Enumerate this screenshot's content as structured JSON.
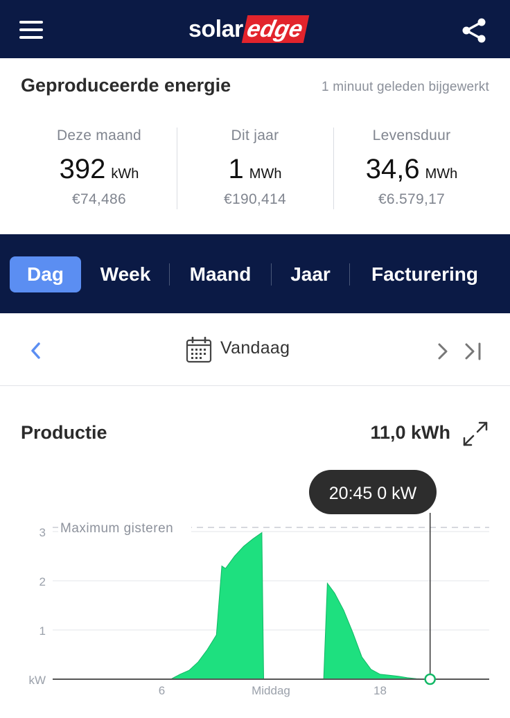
{
  "header": {
    "logo_text_1": "solar",
    "logo_text_2": "edge",
    "menu_icon": "hamburger-menu-icon",
    "share_icon": "share-icon"
  },
  "energy": {
    "title": "Geproduceerde energie",
    "updated": "1 minuut geleden bijgewerkt",
    "stats": [
      {
        "label": "Deze maand",
        "value": "392",
        "unit": "kWh",
        "money": "€74,486"
      },
      {
        "label": "Dit jaar",
        "value": "1",
        "unit": "MWh",
        "money": "€190,414"
      },
      {
        "label": "Levensduur",
        "value": "34,6",
        "unit": "MWh",
        "money": "€6.579,17"
      }
    ]
  },
  "tabs": [
    {
      "label": "Dag",
      "active": true
    },
    {
      "label": "Week",
      "active": false
    },
    {
      "label": "Maand",
      "active": false
    },
    {
      "label": "Jaar",
      "active": false
    },
    {
      "label": "Facturering",
      "active": false
    }
  ],
  "datebar": {
    "label": "Vandaag",
    "calendar_icon": "calendar-icon",
    "prev_icon": "chevron-left-icon",
    "next_icon": "chevron-right-icon",
    "last_icon": "skip-to-end-icon"
  },
  "production": {
    "title": "Productie",
    "total": "11,0 kWh",
    "expand_icon": "expand-icon"
  },
  "colors": {
    "navy": "#0b1a45",
    "accent_blue": "#5b8ef2",
    "brand_red": "#e2242c",
    "area_green": "#1ee07f"
  },
  "chart_data": {
    "type": "area",
    "unit_label": "kW",
    "x_unit": "hours",
    "x_ticks": [
      {
        "x": 6,
        "label": "6"
      },
      {
        "x": 12,
        "label": "Middag"
      },
      {
        "x": 18,
        "label": "18"
      }
    ],
    "y_ticks": [
      1,
      2,
      3
    ],
    "xlim": [
      0,
      24
    ],
    "ylim": [
      0,
      3.3
    ],
    "reference_line": {
      "label": "Maximum gisteren",
      "value": 3.0
    },
    "tooltip": {
      "text": "20:45 0 kW",
      "x": 20.75,
      "y": 0
    },
    "series": [
      {
        "segments": [
          [
            [
              6.5,
              0
            ],
            [
              7.0,
              0.1
            ],
            [
              7.5,
              0.18
            ],
            [
              8.0,
              0.35
            ],
            [
              8.5,
              0.6
            ],
            [
              9.0,
              0.9
            ],
            [
              9.3,
              2.3
            ],
            [
              9.5,
              2.25
            ],
            [
              10.0,
              2.5
            ],
            [
              10.5,
              2.7
            ],
            [
              11.0,
              2.85
            ],
            [
              11.5,
              2.98
            ],
            [
              11.6,
              0
            ]
          ],
          [
            [
              14.9,
              0
            ],
            [
              15.1,
              1.95
            ],
            [
              15.5,
              1.75
            ],
            [
              16.0,
              1.4
            ],
            [
              16.5,
              0.95
            ],
            [
              17.0,
              0.45
            ],
            [
              17.5,
              0.2
            ],
            [
              18.0,
              0.1
            ],
            [
              18.5,
              0.08
            ],
            [
              19.0,
              0.06
            ],
            [
              19.5,
              0.03
            ],
            [
              20.0,
              0.01
            ],
            [
              20.75,
              0
            ]
          ]
        ]
      }
    ]
  }
}
